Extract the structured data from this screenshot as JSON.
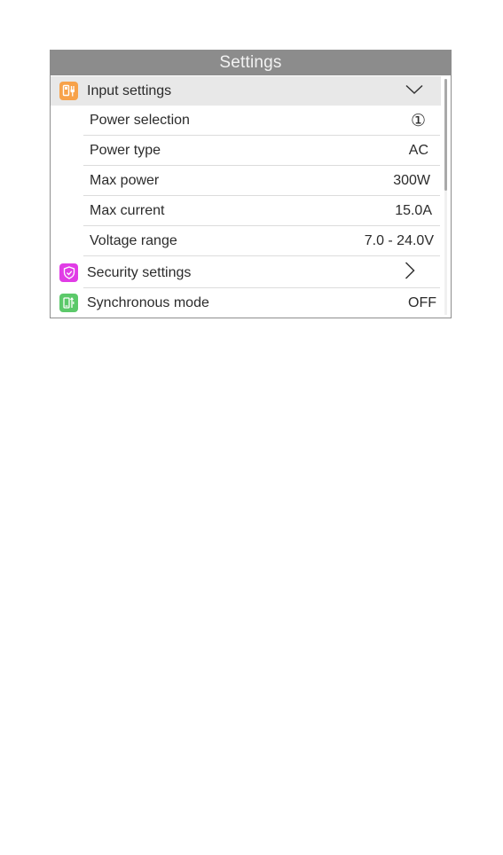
{
  "title": "Settings",
  "input_settings": {
    "label": "Input settings",
    "icon": "power-plug-icon",
    "icon_color": "#f7a24a",
    "expanded_indicator": "chevron-down-icon",
    "items": [
      {
        "label": "Power selection",
        "value": "①"
      },
      {
        "label": "Power type",
        "value": "AC"
      },
      {
        "label": "Max power",
        "value": "300W"
      },
      {
        "label": "Max current",
        "value": "15.0A"
      },
      {
        "label": "Voltage range",
        "value": "7.0 - 24.0V"
      }
    ]
  },
  "security_settings": {
    "label": "Security settings",
    "icon": "shield-icon",
    "icon_color": "#e13ce6",
    "indicator": "chevron-right-icon"
  },
  "synchronous_mode": {
    "label": "Synchronous mode",
    "icon": "sync-device-icon",
    "icon_color": "#5cc96a",
    "value": "OFF"
  },
  "colors": {
    "title_bar": "#8c8c8c",
    "header_row": "#e8e8e8",
    "border": "#8e8e8e"
  }
}
